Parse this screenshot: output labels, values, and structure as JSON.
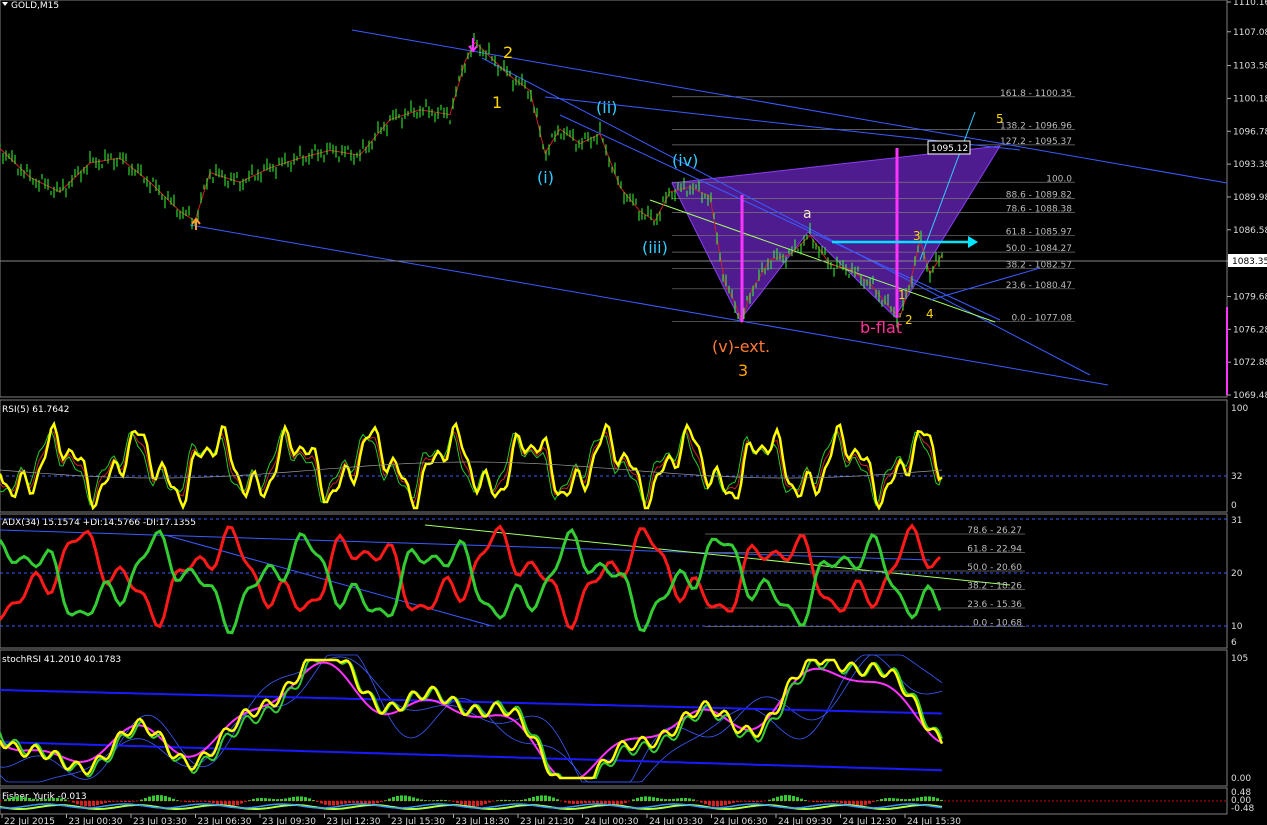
{
  "header": {
    "symbol_title": "GOLD,M15"
  },
  "colors": {
    "background": "#000000",
    "bull_candle": "#33ff33",
    "channel_line": "#3a5cff",
    "rsi_line": "#ffff00",
    "adx_plus": "#33cc33",
    "adx_minus": "#ff1a1a",
    "stoch_ma": "#ff33ff",
    "pattern_fill": "#7a2bd0",
    "label_orange": "#ff9933",
    "label_yellow": "#ffd700",
    "label_cyan": "#33ccff",
    "label_pink": "#ff3399"
  },
  "price_axis": {
    "ticks": [
      "1110.16",
      "1107.08",
      "1103.58",
      "1100.18",
      "1096.78",
      "1093.38",
      "1089.98",
      "1086.58",
      "1083.35",
      "1079.68",
      "1076.28",
      "1072.88",
      "1069.48"
    ],
    "current_price": "1083.35",
    "marker_price": "1095.12"
  },
  "wave_labels": {
    "w1": "1",
    "w2": "2",
    "w3": "3",
    "wi": "(i)",
    "wii": "(ii)",
    "wiii": "(iii)",
    "wiv": "(iv)",
    "wv": "(v)-ext.",
    "a": "a",
    "bflat": "b-flat",
    "s1": "1",
    "s2": "2",
    "s3": "3",
    "s4": "4",
    "s5": "5"
  },
  "fib_levels": [
    "161.8 - 1100.35",
    "138.2 - 1096.96",
    "127.2 - 1095.37",
    "100.0",
    "88.6 - 1089.82",
    "78.6 - 1088.38",
    "61.8 - 1085.97",
    "50.0 - 1084.27",
    "38.2 - 1082.57",
    "23.6 - 1080.47",
    "0.0 - 1077.08"
  ],
  "panels": {
    "rsi": {
      "title": "RSI(5) 61.7642",
      "ticks": [
        "100",
        "32",
        "0"
      ]
    },
    "adx": {
      "title": "ADX(34) 15.1574 +DI:14.5766 -DI:17.1355",
      "ticks": [
        "31",
        "20",
        "10",
        "6"
      ],
      "fib_levels": [
        "78.6 - 26.27",
        "61.8 - 22.94",
        "50.0 - 20.60",
        "38.2 - 18.26",
        "23.6 - 15.36",
        "0.0 - 10.68"
      ]
    },
    "stoch": {
      "title": "stochRSI 41.2010 40.1783",
      "ticks": [
        "105",
        "0.00"
      ]
    },
    "fisher": {
      "title": "Fisher_Yurik -0.013",
      "ticks": [
        "0.48",
        "0.00",
        "-0.48"
      ]
    }
  },
  "time_axis": [
    "22 Jul 2015",
    "23 Jul 00:30",
    "23 Jul 03:30",
    "23 Jul 06:30",
    "23 Jul 09:30",
    "23 Jul 12:30",
    "23 Jul 15:30",
    "23 Jul 18:30",
    "23 Jul 21:30",
    "24 Jul 00:30",
    "24 Jul 03:30",
    "24 Jul 06:30",
    "24 Jul 09:30",
    "24 Jul 12:30",
    "24 Jul 15:30"
  ],
  "chart_data": {
    "type": "line",
    "title": "GOLD,M15",
    "ylim": [
      1069.48,
      1110.16
    ],
    "series": [
      {
        "name": "GOLD,M15",
        "x": [
          0,
          30,
          60,
          90,
          120,
          150,
          180,
          195,
          210,
          240,
          270,
          300,
          330,
          360,
          390,
          420,
          450,
          465,
          475,
          490,
          510,
          530,
          545,
          560,
          580,
          600,
          620,
          640,
          655,
          670,
          690,
          710,
          725,
          735,
          742,
          750,
          770,
          790,
          810,
          830,
          850,
          870,
          890,
          900,
          910,
          920,
          930,
          942
        ],
        "values": [
          1095.0,
          1092.0,
          1090.5,
          1093.5,
          1094.0,
          1091.5,
          1088.5,
          1087.5,
          1092.5,
          1091.5,
          1093.0,
          1094.0,
          1094.8,
          1094.3,
          1098.0,
          1099.0,
          1098.5,
          1104.0,
          1106.0,
          1104.5,
          1102.5,
          1101.0,
          1094.5,
          1097.0,
          1095.5,
          1096.5,
          1091.0,
          1088.5,
          1087.5,
          1090.5,
          1091.0,
          1090.0,
          1081.0,
          1079.0,
          1077.0,
          1080.0,
          1083.5,
          1084.0,
          1086.0,
          1083.0,
          1082.5,
          1081.0,
          1078.5,
          1077.5,
          1081.0,
          1085.5,
          1082.0,
          1084.0
        ]
      }
    ],
    "fib_levels": [
      {
        "pct": 161.8,
        "value": 1100.35
      },
      {
        "pct": 138.2,
        "value": 1096.96
      },
      {
        "pct": 127.2,
        "value": 1095.37
      },
      {
        "pct": 100.0,
        "value": 1091.5
      },
      {
        "pct": 88.6,
        "value": 1089.82
      },
      {
        "pct": 78.6,
        "value": 1088.38
      },
      {
        "pct": 61.8,
        "value": 1085.97
      },
      {
        "pct": 50.0,
        "value": 1084.27
      },
      {
        "pct": 38.2,
        "value": 1082.57
      },
      {
        "pct": 23.6,
        "value": 1080.47
      },
      {
        "pct": 0.0,
        "value": 1077.08
      }
    ],
    "indicators": {
      "rsi_current": 61.7642,
      "adx": 15.1574,
      "plus_di": 14.5766,
      "minus_di": 17.1355,
      "stoch_rsi": [
        41.201,
        40.1783
      ],
      "fisher": -0.013
    },
    "grid": false
  }
}
